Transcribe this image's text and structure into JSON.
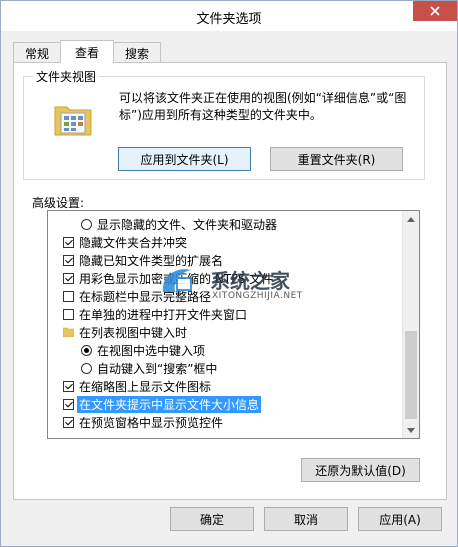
{
  "window": {
    "title": "文件夹选项"
  },
  "tabs": [
    "常规",
    "查看",
    "搜索"
  ],
  "folder_views": {
    "legend": "文件夹视图",
    "description_line1": "可以将该文件夹正在使用的视图(例如“详细信息”或“图",
    "description_line2": "标”)应用到所有这种类型的文件夹中。",
    "apply_button": "应用到文件夹(L)",
    "reset_button": "重置文件夹(R)"
  },
  "advanced": {
    "label": "高级设置:",
    "items": [
      {
        "kind": "radio",
        "checked": false,
        "indent": 1,
        "label": "显示隐藏的文件、文件夹和驱动器"
      },
      {
        "kind": "checkbox",
        "checked": true,
        "indent": 0,
        "label": "隐藏文件夹合并冲突"
      },
      {
        "kind": "checkbox",
        "checked": true,
        "indent": 0,
        "label": "隐藏已知文件类型的扩展名"
      },
      {
        "kind": "checkbox",
        "checked": true,
        "indent": 0,
        "label": "用彩色显示加密或压缩的 NTFS 文件"
      },
      {
        "kind": "checkbox",
        "checked": false,
        "indent": 0,
        "label": "在标题栏中显示完整路径"
      },
      {
        "kind": "checkbox",
        "checked": false,
        "indent": 0,
        "label": "在单独的进程中打开文件夹窗口"
      },
      {
        "kind": "folder",
        "checked": false,
        "indent": 0,
        "label": "在列表视图中键入时"
      },
      {
        "kind": "radio",
        "checked": true,
        "indent": 1,
        "label": "在视图中选中键入项"
      },
      {
        "kind": "radio",
        "checked": false,
        "indent": 1,
        "label": "自动键入到“搜索”框中"
      },
      {
        "kind": "checkbox",
        "checked": true,
        "indent": 0,
        "label": "在缩略图上显示文件图标"
      },
      {
        "kind": "checkbox",
        "checked": true,
        "indent": 0,
        "label": "在文件夹提示中显示文件大小信息",
        "selected": true
      },
      {
        "kind": "checkbox",
        "checked": true,
        "indent": 0,
        "label": "在预览窗格中显示预览控件"
      }
    ],
    "restore_button": "还原为默认值(D)"
  },
  "watermark": {
    "text": "系统之家",
    "url": "XITONGZHIJIA.NET"
  },
  "footer": {
    "ok": "确定",
    "cancel": "取消",
    "apply": "应用(A)"
  },
  "colors": {
    "selection": "#3399ff",
    "close": "#c7504a"
  }
}
